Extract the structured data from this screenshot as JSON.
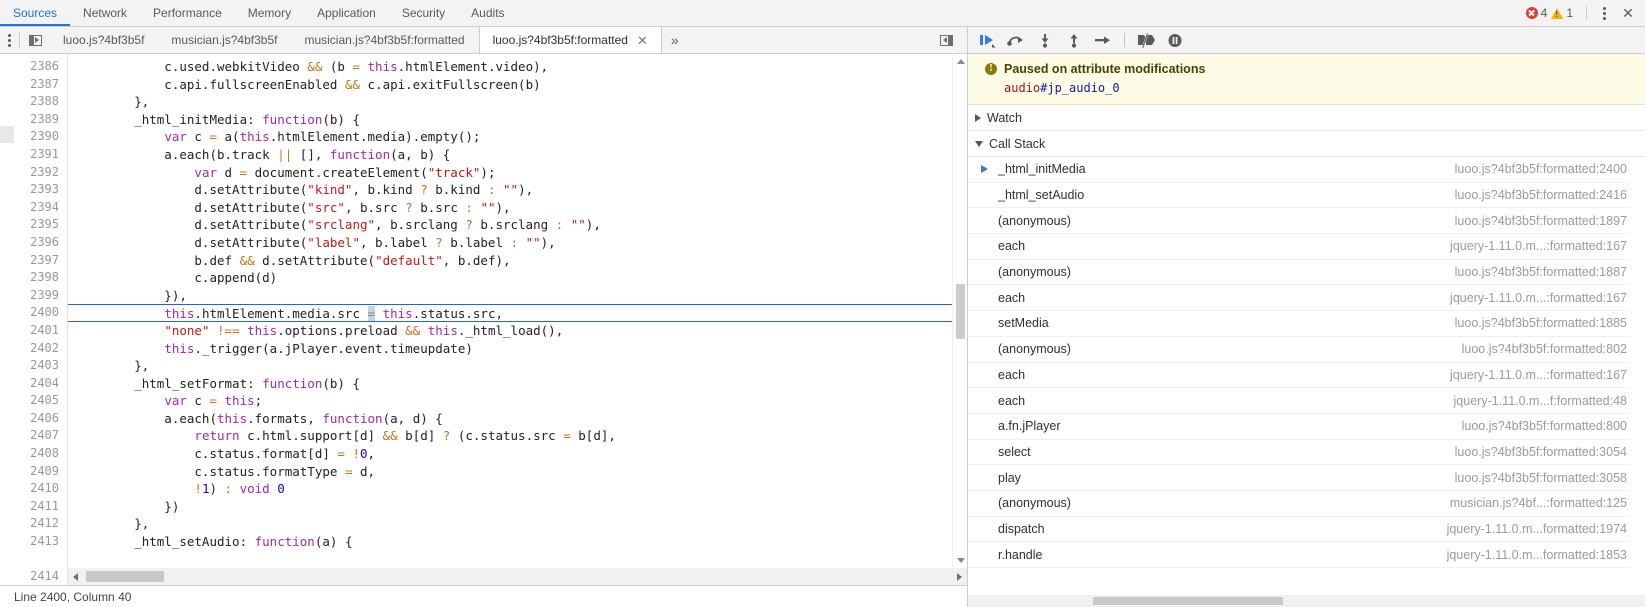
{
  "topbar": {
    "tabs": [
      {
        "label": "Sources",
        "active": true
      },
      {
        "label": "Network",
        "active": false
      },
      {
        "label": "Performance",
        "active": false
      },
      {
        "label": "Memory",
        "active": false
      },
      {
        "label": "Application",
        "active": false
      },
      {
        "label": "Security",
        "active": false
      },
      {
        "label": "Audits",
        "active": false
      }
    ],
    "error_count": "4",
    "warning_count": "1",
    "error_icon": "error-circle-icon",
    "warning_icon": "warning-triangle-icon",
    "menu_icon": "kebab-menu-icon",
    "close_icon": "close-icon",
    "close_label": "✕",
    "accent_color": "#1a73e8",
    "error_color": "#e13c3c",
    "warning_color": "#f5b400"
  },
  "source_toolbar": {
    "menu_icon": "kebab-menu-icon",
    "navigator_toggle_icon": "show-navigator-icon",
    "debugger_toggle_icon": "hide-debugger-icon",
    "file_tabs": [
      {
        "label": "luoo.js?4bf3b5f",
        "active": false,
        "closable": false
      },
      {
        "label": "musician.js?4bf3b5f",
        "active": false,
        "closable": false
      },
      {
        "label": "musician.js?4bf3b5f:formatted",
        "active": false,
        "closable": false
      },
      {
        "label": "luoo.js?4bf3b5f:formatted",
        "active": true,
        "closable": true
      }
    ],
    "tab_close_label": "✕",
    "more_tabs_label": "»"
  },
  "editor": {
    "first_line": 2386,
    "lines": [
      {
        "n": 2386,
        "tokens": [
          {
            "t": "            c.used.webkitVideo ",
            "c": "pl"
          },
          {
            "t": "&&",
            "c": "op"
          },
          {
            "t": " (b ",
            "c": "pl"
          },
          {
            "t": "=",
            "c": "op"
          },
          {
            "t": " ",
            "c": "pl"
          },
          {
            "t": "this",
            "c": "kw"
          },
          {
            "t": ".htmlElement.video),",
            "c": "pl"
          }
        ]
      },
      {
        "n": 2387,
        "tokens": [
          {
            "t": "            c.api.fullscreenEnabled ",
            "c": "pl"
          },
          {
            "t": "&&",
            "c": "op"
          },
          {
            "t": " c.api.exitFullscreen(b)",
            "c": "pl"
          }
        ]
      },
      {
        "n": 2388,
        "tokens": [
          {
            "t": "        },",
            "c": "pl"
          }
        ]
      },
      {
        "n": 2389,
        "tokens": [
          {
            "t": "        _html_initMedia: ",
            "c": "pl"
          },
          {
            "t": "function",
            "c": "kw"
          },
          {
            "t": "(b) {",
            "c": "pl"
          }
        ]
      },
      {
        "n": 2390,
        "tokens": [
          {
            "t": "            ",
            "c": "pl"
          },
          {
            "t": "var",
            "c": "kw"
          },
          {
            "t": " c ",
            "c": "pl"
          },
          {
            "t": "=",
            "c": "op"
          },
          {
            "t": " a(",
            "c": "pl"
          },
          {
            "t": "this",
            "c": "kw"
          },
          {
            "t": ".htmlElement.media).empty();",
            "c": "pl"
          }
        ]
      },
      {
        "n": 2391,
        "tokens": [
          {
            "t": "            a.each(b.track ",
            "c": "pl"
          },
          {
            "t": "||",
            "c": "op"
          },
          {
            "t": " [], ",
            "c": "pl"
          },
          {
            "t": "function",
            "c": "kw"
          },
          {
            "t": "(a, b) {",
            "c": "pl"
          }
        ]
      },
      {
        "n": 2392,
        "tokens": [
          {
            "t": "                ",
            "c": "pl"
          },
          {
            "t": "var",
            "c": "kw"
          },
          {
            "t": " d ",
            "c": "pl"
          },
          {
            "t": "=",
            "c": "op"
          },
          {
            "t": " document.createElement(",
            "c": "pl"
          },
          {
            "t": "\"track\"",
            "c": "str"
          },
          {
            "t": ");",
            "c": "pl"
          }
        ]
      },
      {
        "n": 2393,
        "tokens": [
          {
            "t": "                d.setAttribute(",
            "c": "pl"
          },
          {
            "t": "\"kind\"",
            "c": "str"
          },
          {
            "t": ", b.kind ",
            "c": "pl"
          },
          {
            "t": "?",
            "c": "op"
          },
          {
            "t": " b.kind ",
            "c": "pl"
          },
          {
            "t": ":",
            "c": "op"
          },
          {
            "t": " ",
            "c": "pl"
          },
          {
            "t": "\"\"",
            "c": "str"
          },
          {
            "t": "),",
            "c": "pl"
          }
        ]
      },
      {
        "n": 2394,
        "tokens": [
          {
            "t": "                d.setAttribute(",
            "c": "pl"
          },
          {
            "t": "\"src\"",
            "c": "str"
          },
          {
            "t": ", b.src ",
            "c": "pl"
          },
          {
            "t": "?",
            "c": "op"
          },
          {
            "t": " b.src ",
            "c": "pl"
          },
          {
            "t": ":",
            "c": "op"
          },
          {
            "t": " ",
            "c": "pl"
          },
          {
            "t": "\"\"",
            "c": "str"
          },
          {
            "t": "),",
            "c": "pl"
          }
        ]
      },
      {
        "n": 2395,
        "tokens": [
          {
            "t": "                d.setAttribute(",
            "c": "pl"
          },
          {
            "t": "\"srclang\"",
            "c": "str"
          },
          {
            "t": ", b.srclang ",
            "c": "pl"
          },
          {
            "t": "?",
            "c": "op"
          },
          {
            "t": " b.srclang ",
            "c": "pl"
          },
          {
            "t": ":",
            "c": "op"
          },
          {
            "t": " ",
            "c": "pl"
          },
          {
            "t": "\"\"",
            "c": "str"
          },
          {
            "t": "),",
            "c": "pl"
          }
        ]
      },
      {
        "n": 2396,
        "tokens": [
          {
            "t": "                d.setAttribute(",
            "c": "pl"
          },
          {
            "t": "\"label\"",
            "c": "str"
          },
          {
            "t": ", b.label ",
            "c": "pl"
          },
          {
            "t": "?",
            "c": "op"
          },
          {
            "t": " b.label ",
            "c": "pl"
          },
          {
            "t": ":",
            "c": "op"
          },
          {
            "t": " ",
            "c": "pl"
          },
          {
            "t": "\"\"",
            "c": "str"
          },
          {
            "t": "),",
            "c": "pl"
          }
        ]
      },
      {
        "n": 2397,
        "tokens": [
          {
            "t": "                b.def ",
            "c": "pl"
          },
          {
            "t": "&&",
            "c": "op"
          },
          {
            "t": " d.setAttribute(",
            "c": "pl"
          },
          {
            "t": "\"default\"",
            "c": "str"
          },
          {
            "t": ", b.def),",
            "c": "pl"
          }
        ]
      },
      {
        "n": 2398,
        "tokens": [
          {
            "t": "                c.append(d)",
            "c": "pl"
          }
        ]
      },
      {
        "n": 2399,
        "tokens": [
          {
            "t": "            }),",
            "c": "pl"
          }
        ]
      },
      {
        "n": 2400,
        "exec": true,
        "tokens": [
          {
            "t": "            ",
            "c": "pl"
          },
          {
            "t": "this",
            "c": "kw"
          },
          {
            "t": ".htmlElement.media.src ",
            "c": "pl"
          },
          {
            "t": "=",
            "c": "op",
            "sel": true
          },
          {
            "t": " ",
            "c": "pl"
          },
          {
            "t": "this",
            "c": "kw"
          },
          {
            "t": ".status.src,",
            "c": "pl"
          }
        ]
      },
      {
        "n": 2401,
        "tokens": [
          {
            "t": "            ",
            "c": "pl"
          },
          {
            "t": "\"none\"",
            "c": "str"
          },
          {
            "t": " ",
            "c": "pl"
          },
          {
            "t": "!==",
            "c": "op"
          },
          {
            "t": " ",
            "c": "pl"
          },
          {
            "t": "this",
            "c": "kw"
          },
          {
            "t": ".options.preload ",
            "c": "pl"
          },
          {
            "t": "&&",
            "c": "op"
          },
          {
            "t": " ",
            "c": "pl"
          },
          {
            "t": "this",
            "c": "kw"
          },
          {
            "t": "._html_load(),",
            "c": "pl"
          }
        ]
      },
      {
        "n": 2402,
        "tokens": [
          {
            "t": "            ",
            "c": "pl"
          },
          {
            "t": "this",
            "c": "kw"
          },
          {
            "t": "._trigger(a.jPlayer.event.timeupdate)",
            "c": "pl"
          }
        ]
      },
      {
        "n": 2403,
        "tokens": [
          {
            "t": "        },",
            "c": "pl"
          }
        ]
      },
      {
        "n": 2404,
        "tokens": [
          {
            "t": "        _html_setFormat: ",
            "c": "pl"
          },
          {
            "t": "function",
            "c": "kw"
          },
          {
            "t": "(b) {",
            "c": "pl"
          }
        ]
      },
      {
        "n": 2405,
        "tokens": [
          {
            "t": "            ",
            "c": "pl"
          },
          {
            "t": "var",
            "c": "kw"
          },
          {
            "t": " c ",
            "c": "pl"
          },
          {
            "t": "=",
            "c": "op"
          },
          {
            "t": " ",
            "c": "pl"
          },
          {
            "t": "this",
            "c": "kw"
          },
          {
            "t": ";",
            "c": "pl"
          }
        ]
      },
      {
        "n": 2406,
        "tokens": [
          {
            "t": "            a.each(",
            "c": "pl"
          },
          {
            "t": "this",
            "c": "kw"
          },
          {
            "t": ".formats, ",
            "c": "pl"
          },
          {
            "t": "function",
            "c": "kw"
          },
          {
            "t": "(a, d) {",
            "c": "pl"
          }
        ]
      },
      {
        "n": 2407,
        "tokens": [
          {
            "t": "                ",
            "c": "pl"
          },
          {
            "t": "return",
            "c": "kw"
          },
          {
            "t": " c.html.support[d] ",
            "c": "pl"
          },
          {
            "t": "&&",
            "c": "op"
          },
          {
            "t": " b[d] ",
            "c": "pl"
          },
          {
            "t": "?",
            "c": "op"
          },
          {
            "t": " (c.status.src ",
            "c": "pl"
          },
          {
            "t": "=",
            "c": "op"
          },
          {
            "t": " b[d],",
            "c": "pl"
          }
        ]
      },
      {
        "n": 2408,
        "tokens": [
          {
            "t": "                c.status.format[d] ",
            "c": "pl"
          },
          {
            "t": "=",
            "c": "op"
          },
          {
            "t": " ",
            "c": "pl"
          },
          {
            "t": "!",
            "c": "op"
          },
          {
            "t": "0",
            "c": "num"
          },
          {
            "t": ",",
            "c": "pl"
          }
        ]
      },
      {
        "n": 2409,
        "tokens": [
          {
            "t": "                c.status.formatType ",
            "c": "pl"
          },
          {
            "t": "=",
            "c": "op"
          },
          {
            "t": " d,",
            "c": "pl"
          }
        ]
      },
      {
        "n": 2410,
        "tokens": [
          {
            "t": "                ",
            "c": "pl"
          },
          {
            "t": "!",
            "c": "op"
          },
          {
            "t": "1",
            "c": "num"
          },
          {
            "t": ") ",
            "c": "pl"
          },
          {
            "t": ":",
            "c": "op"
          },
          {
            "t": " ",
            "c": "pl"
          },
          {
            "t": "void",
            "c": "kw"
          },
          {
            "t": " ",
            "c": "pl"
          },
          {
            "t": "0",
            "c": "num"
          }
        ]
      },
      {
        "n": 2411,
        "tokens": [
          {
            "t": "            })",
            "c": "pl"
          }
        ]
      },
      {
        "n": 2412,
        "tokens": [
          {
            "t": "        },",
            "c": "pl"
          }
        ]
      },
      {
        "n": 2413,
        "tokens": [
          {
            "t": "        _html_setAudio: ",
            "c": "pl"
          },
          {
            "t": "function",
            "c": "kw"
          },
          {
            "t": "(a) {",
            "c": "pl"
          }
        ]
      }
    ],
    "scrollbar_line": 2414,
    "h_scroll_left_icon": "scroll-left-arrow-icon",
    "h_scroll_right_icon": "scroll-right-arrow-icon"
  },
  "status_bar": {
    "text": "Line 2400, Column 40"
  },
  "debugger_toolbar": {
    "buttons": [
      {
        "name": "resume-script-execution-button",
        "icon": "resume-icon"
      },
      {
        "name": "step-over-button",
        "icon": "step-over-icon"
      },
      {
        "name": "step-into-button",
        "icon": "step-into-icon"
      },
      {
        "name": "step-out-button",
        "icon": "step-out-icon"
      },
      {
        "name": "step-button",
        "icon": "step-arrow-icon"
      },
      {
        "name": "deactivate-breakpoints-button",
        "icon": "deactivate-breakpoints-icon"
      },
      {
        "name": "pause-on-exceptions-button",
        "icon": "pause-icon"
      }
    ],
    "resume_color": "#3b78e7"
  },
  "paused_banner": {
    "icon": "info-icon",
    "icon_glyph": "!",
    "title": "Paused on attribute modifications",
    "node_tag": "audio",
    "node_id": "#jp_audio_0"
  },
  "sidebar": {
    "watch": {
      "label": "Watch",
      "expanded": false,
      "caret_icon": "chevron-right-icon"
    },
    "call_stack": {
      "label": "Call Stack",
      "expanded": true,
      "caret_icon": "chevron-down-icon"
    },
    "frames": [
      {
        "fn": "_html_initMedia",
        "loc": "luoo.js?4bf3b5f:formatted:2400",
        "selected": true
      },
      {
        "fn": "_html_setAudio",
        "loc": "luoo.js?4bf3b5f:formatted:2416",
        "selected": false
      },
      {
        "fn": "(anonymous)",
        "loc": "luoo.js?4bf3b5f:formatted:1897",
        "selected": false
      },
      {
        "fn": "each",
        "loc": "jquery-1.11.0.m...:formatted:167",
        "selected": false
      },
      {
        "fn": "(anonymous)",
        "loc": "luoo.js?4bf3b5f:formatted:1887",
        "selected": false
      },
      {
        "fn": "each",
        "loc": "jquery-1.11.0.m...:formatted:167",
        "selected": false
      },
      {
        "fn": "setMedia",
        "loc": "luoo.js?4bf3b5f:formatted:1885",
        "selected": false
      },
      {
        "fn": "(anonymous)",
        "loc": "luoo.js?4bf3b5f:formatted:802",
        "selected": false
      },
      {
        "fn": "each",
        "loc": "jquery-1.11.0.m...:formatted:167",
        "selected": false
      },
      {
        "fn": "each",
        "loc": "jquery-1.11.0.m...f:formatted:48",
        "selected": false
      },
      {
        "fn": "a.fn.jPlayer",
        "loc": "luoo.js?4bf3b5f:formatted:800",
        "selected": false
      },
      {
        "fn": "select",
        "loc": "luoo.js?4bf3b5f:formatted:3054",
        "selected": false
      },
      {
        "fn": "play",
        "loc": "luoo.js?4bf3b5f:formatted:3058",
        "selected": false
      },
      {
        "fn": "(anonymous)",
        "loc": "musician.js?4bf...:formatted:125",
        "selected": false
      },
      {
        "fn": "dispatch",
        "loc": "jquery-1.11.0.m...formatted:1974",
        "selected": false
      },
      {
        "fn": "r.handle",
        "loc": "jquery-1.11.0.m...formatted:1853",
        "selected": false
      }
    ]
  }
}
